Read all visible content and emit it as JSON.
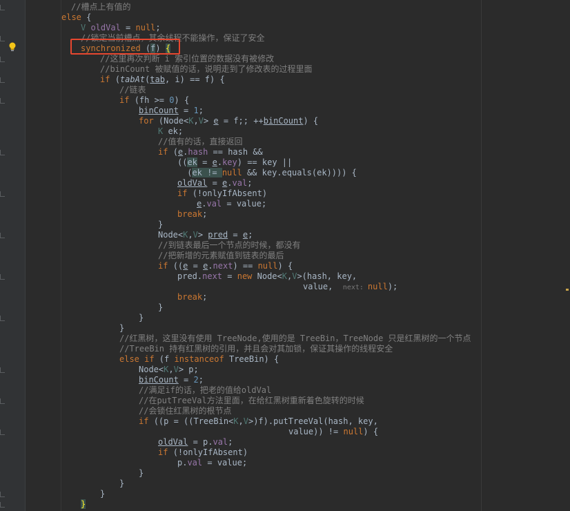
{
  "editor": {
    "language": "Java",
    "theme": "darcula",
    "colors": {
      "background": "#2b2b2b",
      "keyword": "#cc7832",
      "comment": "#808080",
      "number": "#6897bb",
      "field": "#9876aa",
      "type_param": "#507874",
      "method_decl": "#ffc66d",
      "highlight_box": "#e8472f"
    },
    "gutter_icons": [
      "intention-bulb-icon",
      "fold-marker-icon"
    ],
    "annotation": "red-outline-around-synchronized-line"
  },
  "lines": [
    [
      [
        "cm",
        "//槽点上有值的"
      ]
    ],
    [
      [
        "kw",
        "else "
      ],
      [
        "plain",
        "{"
      ]
    ],
    [
      [
        "tp",
        "V "
      ],
      [
        "field",
        "oldVal"
      ],
      [
        "plain",
        " = "
      ],
      [
        "kw",
        "null"
      ],
      [
        "plain",
        ";"
      ]
    ],
    [
      [
        "cm",
        "//锁定当前槽点，其余线程不能操作，保证了安全"
      ]
    ],
    [
      [
        "kw",
        "synchronized "
      ],
      [
        "plain",
        "("
      ],
      [
        "hl",
        "f"
      ],
      [
        "plain",
        ") "
      ],
      [
        "bracket",
        "{"
      ]
    ],
    [
      [
        "cm",
        "//这里再次判断 i 索引位置的数据没有被修改"
      ]
    ],
    [
      [
        "cm",
        "//binCount 被赋值的话，说明走到了修改表的过程里面"
      ]
    ],
    [
      [
        "kw",
        "if "
      ],
      [
        "plain",
        "("
      ],
      [
        "it",
        "tabAt"
      ],
      [
        "plain",
        "("
      ],
      [
        "ul",
        "tab"
      ],
      [
        "plain",
        ", i) == f) {"
      ]
    ],
    [
      [
        "cm",
        "//链表"
      ]
    ],
    [
      [
        "kw",
        "if "
      ],
      [
        "plain",
        "(fh >= "
      ],
      [
        "num",
        "0"
      ],
      [
        "plain",
        ") {"
      ]
    ],
    [
      [
        "ul",
        "binCount"
      ],
      [
        "plain",
        " = "
      ],
      [
        "num",
        "1"
      ],
      [
        "plain",
        ";"
      ]
    ],
    [
      [
        "kw",
        "for "
      ],
      [
        "plain",
        "(Node<"
      ],
      [
        "tp",
        "K"
      ],
      [
        "plain",
        ","
      ],
      [
        "tp",
        "V"
      ],
      [
        "plain",
        "> "
      ],
      [
        "ul",
        "e"
      ],
      [
        "plain",
        " = f;; ++"
      ],
      [
        "ul",
        "binCount"
      ],
      [
        "plain",
        ") {"
      ]
    ],
    [
      [
        "tp",
        "K "
      ],
      [
        "plain",
        "ek;"
      ]
    ],
    [
      [
        "cm",
        "//值有的话，直接返回"
      ]
    ],
    [
      [
        "kw",
        "if "
      ],
      [
        "plain",
        "("
      ],
      [
        "ul",
        "e"
      ],
      [
        "plain",
        "."
      ],
      [
        "field",
        "hash"
      ],
      [
        "plain",
        " == hash &&"
      ]
    ],
    [
      [
        "plain",
        "(("
      ],
      [
        "hl",
        "ek"
      ],
      [
        "plain",
        " = "
      ],
      [
        "ul",
        "e"
      ],
      [
        "plain",
        "."
      ],
      [
        "field",
        "key"
      ],
      [
        "plain",
        ") == key ||"
      ]
    ],
    [
      [
        "plain",
        " ("
      ],
      [
        "hl",
        "ek != "
      ],
      [
        "kw",
        "null"
      ],
      [
        "plain",
        " && key.equals(ek)))) {"
      ]
    ],
    [
      [
        "ul",
        "oldVal"
      ],
      [
        "plain",
        " = "
      ],
      [
        "ul",
        "e"
      ],
      [
        "plain",
        "."
      ],
      [
        "field",
        "val"
      ],
      [
        "plain",
        ";"
      ]
    ],
    [
      [
        "kw",
        "if "
      ],
      [
        "plain",
        "(!onlyIfAbsent)"
      ]
    ],
    [
      [
        "ul",
        "e"
      ],
      [
        "plain",
        "."
      ],
      [
        "field",
        "val"
      ],
      [
        "plain",
        " = value;"
      ]
    ],
    [
      [
        "kw",
        "break"
      ],
      [
        "plain",
        ";"
      ]
    ],
    [
      [
        "plain",
        "}"
      ]
    ],
    [
      [
        "plain",
        "Node<"
      ],
      [
        "tp",
        "K"
      ],
      [
        "plain",
        ","
      ],
      [
        "tp",
        "V"
      ],
      [
        "plain",
        "> "
      ],
      [
        "ul",
        "pred"
      ],
      [
        "plain",
        " = "
      ],
      [
        "ul",
        "e"
      ],
      [
        "plain",
        ";"
      ]
    ],
    [
      [
        "cm",
        "//到链表最后一个节点的时候，都没有"
      ]
    ],
    [
      [
        "cm",
        "//把新增的元素赋值到链表的最后"
      ]
    ],
    [
      [
        "kw",
        "if "
      ],
      [
        "plain",
        "(("
      ],
      [
        "ul",
        "e"
      ],
      [
        "plain",
        " = "
      ],
      [
        "ul",
        "e"
      ],
      [
        "plain",
        "."
      ],
      [
        "field",
        "next"
      ],
      [
        "plain",
        ") == "
      ],
      [
        "kw",
        "null"
      ],
      [
        "plain",
        ") {"
      ]
    ],
    [
      [
        "plain",
        "pred."
      ],
      [
        "field",
        "next"
      ],
      [
        "plain",
        " = "
      ],
      [
        "kw",
        "new "
      ],
      [
        "plain",
        "Node<"
      ],
      [
        "tp",
        "K"
      ],
      [
        "plain",
        ","
      ],
      [
        "tp",
        "V"
      ],
      [
        "plain",
        ">(hash, key,"
      ]
    ],
    [
      [
        "plain",
        "value,  "
      ],
      [
        "hint",
        "next: "
      ],
      [
        "kw",
        "null"
      ],
      [
        "plain",
        ");"
      ]
    ],
    [
      [
        "kw",
        "break"
      ],
      [
        "plain",
        ";"
      ]
    ],
    [
      [
        "plain",
        "}"
      ]
    ],
    [
      [
        "plain",
        "}"
      ]
    ],
    [
      [
        "plain",
        "}"
      ]
    ],
    [
      [
        "cm",
        "//红黑树，这里没有使用 TreeNode,使用的是 TreeBin，TreeNode 只是红黑树的一个节点"
      ]
    ],
    [
      [
        "cm",
        "//TreeBin 持有红黑树的引用，并且会对其加锁，保证其操作的线程安全"
      ]
    ],
    [
      [
        "kw",
        "else if "
      ],
      [
        "plain",
        "(f "
      ],
      [
        "kw",
        "instanceof "
      ],
      [
        "plain",
        "TreeBin) {"
      ]
    ],
    [
      [
        "plain",
        "Node<"
      ],
      [
        "tp",
        "K"
      ],
      [
        "plain",
        ","
      ],
      [
        "tp",
        "V"
      ],
      [
        "plain",
        "> p;"
      ]
    ],
    [
      [
        "ul",
        "binCount"
      ],
      [
        "plain",
        " = "
      ],
      [
        "num",
        "2"
      ],
      [
        "plain",
        ";"
      ]
    ],
    [
      [
        "cm",
        "//满足if的话，把老的值给oldVal"
      ]
    ],
    [
      [
        "cm",
        "//在putTreeVal方法里面，在给红黑树重新着色旋转的时候"
      ]
    ],
    [
      [
        "cm",
        "//会锁住红黑树的根节点"
      ]
    ],
    [
      [
        "kw",
        "if "
      ],
      [
        "plain",
        "((p = ((TreeBin<"
      ],
      [
        "tp",
        "K"
      ],
      [
        "plain",
        ","
      ],
      [
        "tp",
        "V"
      ],
      [
        "plain",
        ">)f).putTreeVal(hash, key,"
      ]
    ],
    [
      [
        "plain",
        "value)) != "
      ],
      [
        "kw",
        "null"
      ],
      [
        "plain",
        ") {"
      ]
    ],
    [
      [
        "ul",
        "oldVal"
      ],
      [
        "plain",
        " = p."
      ],
      [
        "field",
        "val"
      ],
      [
        "plain",
        ";"
      ]
    ],
    [
      [
        "kw",
        "if "
      ],
      [
        "plain",
        "(!onlyIfAbsent)"
      ]
    ],
    [
      [
        "plain",
        "p."
      ],
      [
        "field",
        "val"
      ],
      [
        "plain",
        " = value;"
      ]
    ],
    [
      [
        "plain",
        "}"
      ]
    ],
    [
      [
        "plain",
        "}"
      ]
    ],
    [
      [
        "plain",
        "}"
      ]
    ],
    [
      [
        "bracket",
        "}"
      ]
    ]
  ]
}
